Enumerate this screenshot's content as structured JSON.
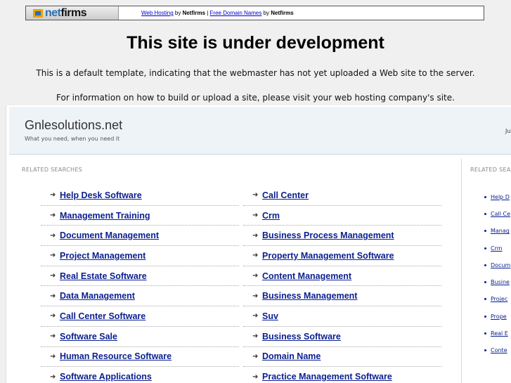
{
  "banner": {
    "logo_text_pre": "net",
    "logo_text_main": "firms",
    "link_hosting": "Web Hosting",
    "by1": " by ",
    "brand1": "Netfirms",
    "sep": " | ",
    "link_domains": "Free Domain Names",
    "by2": " by ",
    "brand2": "Netfirms"
  },
  "notice": {
    "title": "This site is under development",
    "line1": "This is a default template, indicating that the webmaster has not yet uploaded a Web site to the server.",
    "line2": "For information on how to build or upload a site, please visit your web hosting company's site."
  },
  "parked": {
    "site_name": "Gnlesolutions.net",
    "tagline": "What you need, when you need it",
    "date_partial": "Ju",
    "related_label": "RELATED SEARCHES",
    "related_label_right": "RELATED SEA",
    "left_column": [
      "Help Desk Software",
      "Management Training",
      "Document Management",
      "Project Management",
      "Real Estate Software",
      "Data Management",
      "Call Center Software",
      "Software Sale",
      "Human Resource Software",
      "Software Applications"
    ],
    "right_column": [
      "Call Center",
      "Crm",
      "Business Process Management",
      "Property Management Software",
      "Content Management",
      "Business Management",
      "Suv",
      "Business Software",
      "Domain Name",
      "Practice Management Software"
    ],
    "sidebar": [
      "Help D",
      "Call Ce",
      "Manag",
      "Crm",
      "Docum",
      "Busine",
      "Projec",
      "Prope",
      "Real E",
      "Conte"
    ]
  }
}
